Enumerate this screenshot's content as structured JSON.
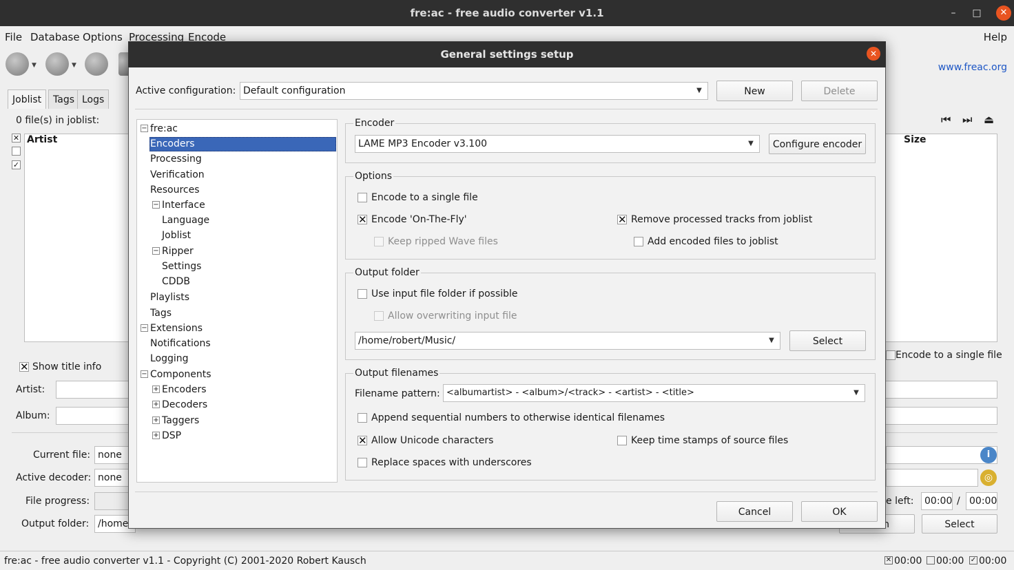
{
  "window": {
    "title": "fre:ac - free audio converter v1.1",
    "minimize": "–",
    "maximize": "□",
    "close": "✕"
  },
  "menubar": [
    "File",
    "Database",
    "Options",
    "Processing",
    "Encode",
    "Help"
  ],
  "website": "www.freac.org",
  "tabs": [
    "Joblist",
    "Tags",
    "Logs"
  ],
  "joblist": {
    "count": "0 file(s) in joblist:",
    "columns": {
      "artist": "Artist",
      "size": "Size"
    }
  },
  "behind": {
    "show_title_info": "Show title info",
    "artist_label": "Artist:",
    "album_label": "Album:",
    "current_file_label": "Current file:",
    "current_file": "none",
    "active_decoder_label": "Active decoder:",
    "active_decoder": "none",
    "file_progress_label": "File progress:",
    "output_folder_label": "Output folder:",
    "output_folder": "/home",
    "encode_single": "Encode to a single file",
    "time_left_label": "e left:",
    "time_left_a": "00:00",
    "time_sep": "/",
    "time_left_b": "00:00",
    "select": "Select",
    "open_partial": "n"
  },
  "statusbar": {
    "text": "fre:ac - free audio converter v1.1 - Copyright (C) 2001-2020 Robert Kausch",
    "t1": "00:00",
    "t2": "00:00",
    "t3": "00:00"
  },
  "dialog": {
    "title": "General settings setup",
    "active_config_label": "Active configuration:",
    "active_config": "Default configuration",
    "new": "New",
    "delete": "Delete",
    "tree": {
      "root": "fre:ac",
      "encoders": "Encoders",
      "processing": "Processing",
      "verification": "Verification",
      "resources": "Resources",
      "interface": "Interface",
      "language": "Language",
      "joblist": "Joblist",
      "ripper": "Ripper",
      "settings": "Settings",
      "cddb": "CDDB",
      "playlists": "Playlists",
      "tags": "Tags",
      "extensions": "Extensions",
      "notifications": "Notifications",
      "logging": "Logging",
      "components": "Components",
      "c_encoders": "Encoders",
      "c_decoders": "Decoders",
      "c_taggers": "Taggers",
      "c_dsp": "DSP"
    },
    "encoder_group": "Encoder",
    "encoder": "LAME MP3 Encoder v3.100",
    "configure_encoder": "Configure encoder",
    "options_group": "Options",
    "opt_single": "Encode to a single file",
    "opt_otf": "Encode 'On-The-Fly'",
    "opt_keep_wave": "Keep ripped Wave files",
    "opt_remove": "Remove processed tracks from joblist",
    "opt_add": "Add encoded files to joblist",
    "output_group": "Output folder",
    "use_input": "Use input file folder if possible",
    "allow_overwrite": "Allow overwriting input file",
    "output_path": "/home/robert/Music/",
    "select": "Select",
    "filenames_group": "Output filenames",
    "pattern_label": "Filename pattern:",
    "pattern": "<albumartist> - <album>/<track> - <artist> - <title>",
    "append_seq": "Append sequential numbers to otherwise identical filenames",
    "unicode": "Allow Unicode characters",
    "keep_ts": "Keep time stamps of source files",
    "replace_spaces": "Replace spaces with underscores",
    "cancel": "Cancel",
    "ok": "OK",
    "checked": "✕"
  }
}
